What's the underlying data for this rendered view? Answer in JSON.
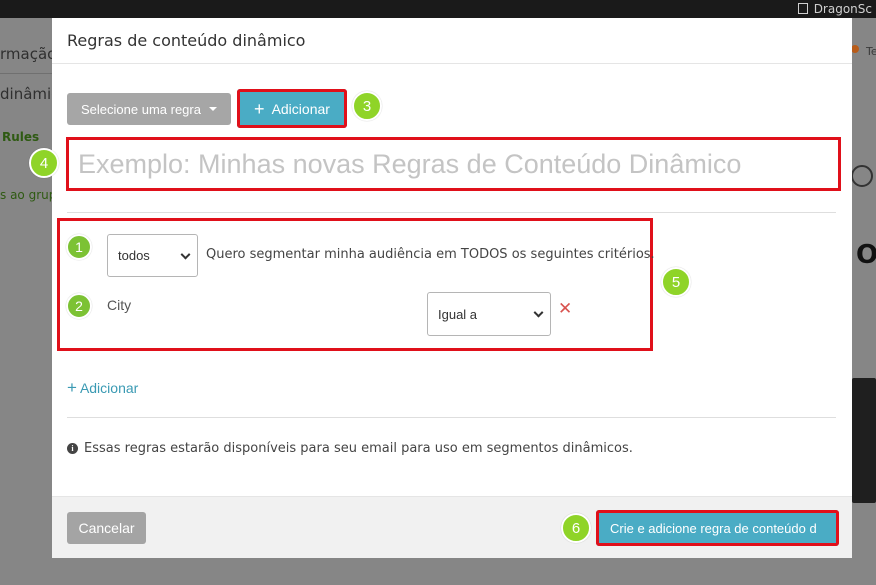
{
  "background": {
    "brand_text": "DragonSc",
    "left_text_1": "rmação",
    "left_text_2": "dinâmico",
    "left_text_3": "Rules",
    "left_text_4": "s ao grup",
    "right_text": "Te",
    "right_big": "OL"
  },
  "modal": {
    "title": "Regras de conteúdo dinâmico",
    "select_rule_label": "Selecione uma regra",
    "add_button_label": "Adicionar",
    "name_placeholder": "Exemplo: Minhas novas Regras de Conteúdo Dinâmico",
    "name_value": "",
    "match_select": "todos",
    "criteria_text": "Quero segmentar minha audiência em TODOS os seguintes critérios.",
    "condition_field": "City",
    "operator_select": "Igual a",
    "add_condition_label": "Adicionar",
    "info_text": "Essas regras estarão disponíveis para seu email para uso em segmentos dinâmicos.",
    "cancel_label": "Cancelar",
    "create_label": "Crie e adicione regra de conteúdo d"
  },
  "badges": {
    "b1": "1",
    "b2": "2",
    "b3": "3",
    "b4": "4",
    "b5": "5",
    "b6": "6"
  },
  "colors": {
    "accent": "#4aacc5",
    "highlight": "#e0101a",
    "badge": "#8fd428",
    "remove": "#d9534f"
  }
}
